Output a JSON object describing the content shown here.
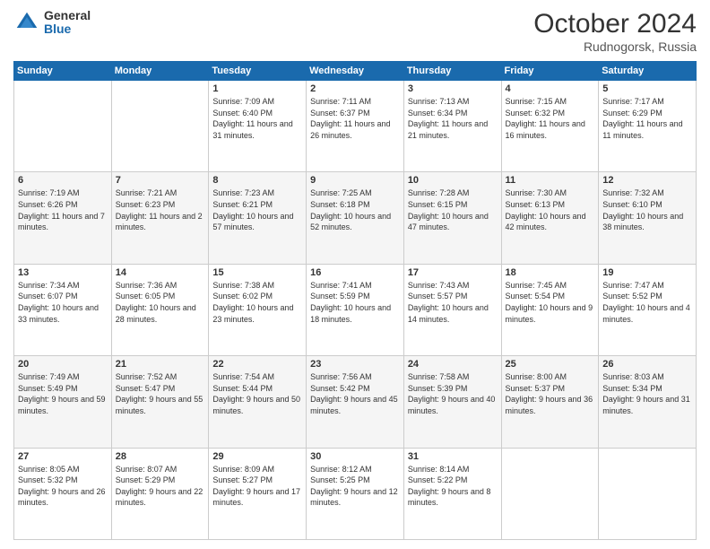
{
  "header": {
    "logo": {
      "general": "General",
      "blue": "Blue"
    },
    "title": "October 2024",
    "location": "Rudnogorsk, Russia"
  },
  "weekdays": [
    "Sunday",
    "Monday",
    "Tuesday",
    "Wednesday",
    "Thursday",
    "Friday",
    "Saturday"
  ],
  "weeks": [
    [
      {
        "day": "",
        "sunrise": "",
        "sunset": "",
        "daylight": ""
      },
      {
        "day": "",
        "sunrise": "",
        "sunset": "",
        "daylight": ""
      },
      {
        "day": "1",
        "sunrise": "Sunrise: 7:09 AM",
        "sunset": "Sunset: 6:40 PM",
        "daylight": "Daylight: 11 hours and 31 minutes."
      },
      {
        "day": "2",
        "sunrise": "Sunrise: 7:11 AM",
        "sunset": "Sunset: 6:37 PM",
        "daylight": "Daylight: 11 hours and 26 minutes."
      },
      {
        "day": "3",
        "sunrise": "Sunrise: 7:13 AM",
        "sunset": "Sunset: 6:34 PM",
        "daylight": "Daylight: 11 hours and 21 minutes."
      },
      {
        "day": "4",
        "sunrise": "Sunrise: 7:15 AM",
        "sunset": "Sunset: 6:32 PM",
        "daylight": "Daylight: 11 hours and 16 minutes."
      },
      {
        "day": "5",
        "sunrise": "Sunrise: 7:17 AM",
        "sunset": "Sunset: 6:29 PM",
        "daylight": "Daylight: 11 hours and 11 minutes."
      }
    ],
    [
      {
        "day": "6",
        "sunrise": "Sunrise: 7:19 AM",
        "sunset": "Sunset: 6:26 PM",
        "daylight": "Daylight: 11 hours and 7 minutes."
      },
      {
        "day": "7",
        "sunrise": "Sunrise: 7:21 AM",
        "sunset": "Sunset: 6:23 PM",
        "daylight": "Daylight: 11 hours and 2 minutes."
      },
      {
        "day": "8",
        "sunrise": "Sunrise: 7:23 AM",
        "sunset": "Sunset: 6:21 PM",
        "daylight": "Daylight: 10 hours and 57 minutes."
      },
      {
        "day": "9",
        "sunrise": "Sunrise: 7:25 AM",
        "sunset": "Sunset: 6:18 PM",
        "daylight": "Daylight: 10 hours and 52 minutes."
      },
      {
        "day": "10",
        "sunrise": "Sunrise: 7:28 AM",
        "sunset": "Sunset: 6:15 PM",
        "daylight": "Daylight: 10 hours and 47 minutes."
      },
      {
        "day": "11",
        "sunrise": "Sunrise: 7:30 AM",
        "sunset": "Sunset: 6:13 PM",
        "daylight": "Daylight: 10 hours and 42 minutes."
      },
      {
        "day": "12",
        "sunrise": "Sunrise: 7:32 AM",
        "sunset": "Sunset: 6:10 PM",
        "daylight": "Daylight: 10 hours and 38 minutes."
      }
    ],
    [
      {
        "day": "13",
        "sunrise": "Sunrise: 7:34 AM",
        "sunset": "Sunset: 6:07 PM",
        "daylight": "Daylight: 10 hours and 33 minutes."
      },
      {
        "day": "14",
        "sunrise": "Sunrise: 7:36 AM",
        "sunset": "Sunset: 6:05 PM",
        "daylight": "Daylight: 10 hours and 28 minutes."
      },
      {
        "day": "15",
        "sunrise": "Sunrise: 7:38 AM",
        "sunset": "Sunset: 6:02 PM",
        "daylight": "Daylight: 10 hours and 23 minutes."
      },
      {
        "day": "16",
        "sunrise": "Sunrise: 7:41 AM",
        "sunset": "Sunset: 5:59 PM",
        "daylight": "Daylight: 10 hours and 18 minutes."
      },
      {
        "day": "17",
        "sunrise": "Sunrise: 7:43 AM",
        "sunset": "Sunset: 5:57 PM",
        "daylight": "Daylight: 10 hours and 14 minutes."
      },
      {
        "day": "18",
        "sunrise": "Sunrise: 7:45 AM",
        "sunset": "Sunset: 5:54 PM",
        "daylight": "Daylight: 10 hours and 9 minutes."
      },
      {
        "day": "19",
        "sunrise": "Sunrise: 7:47 AM",
        "sunset": "Sunset: 5:52 PM",
        "daylight": "Daylight: 10 hours and 4 minutes."
      }
    ],
    [
      {
        "day": "20",
        "sunrise": "Sunrise: 7:49 AM",
        "sunset": "Sunset: 5:49 PM",
        "daylight": "Daylight: 9 hours and 59 minutes."
      },
      {
        "day": "21",
        "sunrise": "Sunrise: 7:52 AM",
        "sunset": "Sunset: 5:47 PM",
        "daylight": "Daylight: 9 hours and 55 minutes."
      },
      {
        "day": "22",
        "sunrise": "Sunrise: 7:54 AM",
        "sunset": "Sunset: 5:44 PM",
        "daylight": "Daylight: 9 hours and 50 minutes."
      },
      {
        "day": "23",
        "sunrise": "Sunrise: 7:56 AM",
        "sunset": "Sunset: 5:42 PM",
        "daylight": "Daylight: 9 hours and 45 minutes."
      },
      {
        "day": "24",
        "sunrise": "Sunrise: 7:58 AM",
        "sunset": "Sunset: 5:39 PM",
        "daylight": "Daylight: 9 hours and 40 minutes."
      },
      {
        "day": "25",
        "sunrise": "Sunrise: 8:00 AM",
        "sunset": "Sunset: 5:37 PM",
        "daylight": "Daylight: 9 hours and 36 minutes."
      },
      {
        "day": "26",
        "sunrise": "Sunrise: 8:03 AM",
        "sunset": "Sunset: 5:34 PM",
        "daylight": "Daylight: 9 hours and 31 minutes."
      }
    ],
    [
      {
        "day": "27",
        "sunrise": "Sunrise: 8:05 AM",
        "sunset": "Sunset: 5:32 PM",
        "daylight": "Daylight: 9 hours and 26 minutes."
      },
      {
        "day": "28",
        "sunrise": "Sunrise: 8:07 AM",
        "sunset": "Sunset: 5:29 PM",
        "daylight": "Daylight: 9 hours and 22 minutes."
      },
      {
        "day": "29",
        "sunrise": "Sunrise: 8:09 AM",
        "sunset": "Sunset: 5:27 PM",
        "daylight": "Daylight: 9 hours and 17 minutes."
      },
      {
        "day": "30",
        "sunrise": "Sunrise: 8:12 AM",
        "sunset": "Sunset: 5:25 PM",
        "daylight": "Daylight: 9 hours and 12 minutes."
      },
      {
        "day": "31",
        "sunrise": "Sunrise: 8:14 AM",
        "sunset": "Sunset: 5:22 PM",
        "daylight": "Daylight: 9 hours and 8 minutes."
      },
      {
        "day": "",
        "sunrise": "",
        "sunset": "",
        "daylight": ""
      },
      {
        "day": "",
        "sunrise": "",
        "sunset": "",
        "daylight": ""
      }
    ]
  ]
}
